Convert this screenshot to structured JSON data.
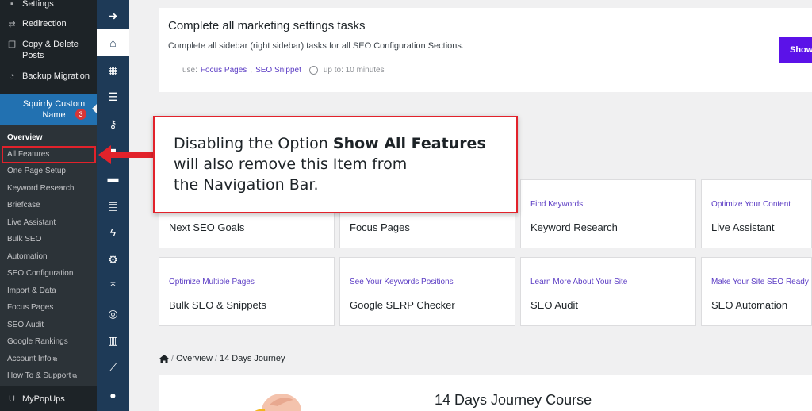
{
  "wp_menu": {
    "items": [
      {
        "label": "Settings",
        "icon": "settings-icon"
      },
      {
        "label": "Redirection",
        "icon": "redirection-icon"
      },
      {
        "label": "Copy & Delete Posts",
        "icon": "copy-icon"
      },
      {
        "label": "Backup Migration",
        "icon": "backup-icon"
      },
      {
        "label": "MyPopUps",
        "icon": "popup-icon"
      }
    ],
    "active": {
      "label": "Squirrly Custom Name",
      "badge": "3"
    }
  },
  "submenu": {
    "items": [
      "Overview",
      "All Features",
      "One Page Setup",
      "Keyword Research",
      "Briefcase",
      "Live Assistant",
      "Bulk SEO",
      "Automation",
      "SEO Configuration",
      "Import & Data",
      "Focus Pages",
      "SEO Audit",
      "Google Rankings",
      "Account Info",
      "How To & Support"
    ],
    "external_marker": "⧉"
  },
  "rail": {
    "icons": [
      "arrow-right-icon",
      "home-icon",
      "dashboard-icon",
      "list-icon",
      "key-icon",
      "briefcase-icon",
      "chat-icon",
      "table-icon",
      "bolt-icon",
      "gears-icon",
      "upload-icon",
      "target-icon",
      "bar-chart-icon",
      "line-chart-icon",
      "user-icon"
    ],
    "glyphs": [
      "➜",
      "⌂",
      "▦",
      "☰",
      "⚷",
      "▣",
      "▬",
      "▤",
      "ϟ",
      "⚙",
      "⤒",
      "◎",
      "▥",
      "⟋",
      "●"
    ]
  },
  "task": {
    "title": "Complete all marketing settings tasks",
    "description": "Complete all sidebar (right sidebar) tasks for all SEO Configuration Sections.",
    "use_label": "use:",
    "links": [
      "Focus Pages",
      "SEO Snippet"
    ],
    "time": "up to: 10 minutes",
    "button": "Show"
  },
  "cards": [
    {
      "sub": "",
      "title": "Next SEO Goals"
    },
    {
      "sub": "",
      "title": "Focus Pages"
    },
    {
      "sub": "Find Keywords",
      "title": "Keyword Research"
    },
    {
      "sub": "Optimize Your Content",
      "title": "Live Assistant"
    },
    {
      "sub": "Optimize Multiple Pages",
      "title": "Bulk SEO & Snippets"
    },
    {
      "sub": "See Your Keywords Positions",
      "title": "Google SERP Checker"
    },
    {
      "sub": "Learn More About Your Site",
      "title": "SEO Audit"
    },
    {
      "sub": "Make Your Site SEO Ready",
      "title": "SEO Automation"
    }
  ],
  "breadcrumb": {
    "sep": "/",
    "items": [
      "Overview",
      "14 Days Journey"
    ]
  },
  "journey": {
    "title": "14 Days Journey Course"
  },
  "callout": {
    "line1_pre": "Disabling the Option ",
    "line1_bold": "Show All Features",
    "line2": "will also remove this Item from",
    "line3": "the Navigation Bar."
  },
  "colors": {
    "accent": "#5b12e8",
    "annotation": "#e2222b",
    "rail": "#1e3a57"
  }
}
